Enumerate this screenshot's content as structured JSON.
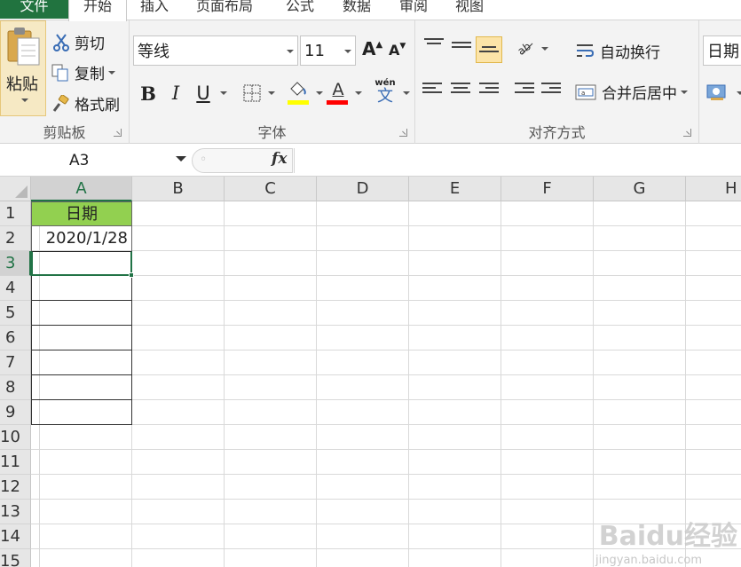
{
  "tabs": {
    "file": "文件",
    "home": "开始",
    "insert": "插入",
    "page_layout": "页面布局",
    "formulas": "公式",
    "data": "数据",
    "review": "审阅",
    "view": "视图"
  },
  "ribbon": {
    "clipboard": {
      "group_label": "剪贴板",
      "paste": "粘贴",
      "cut": "剪切",
      "copy": "复制",
      "format_painter": "格式刷"
    },
    "font": {
      "group_label": "字体",
      "font_name": "等线",
      "font_size": "11",
      "bold": "B",
      "italic": "I",
      "underline": "U",
      "font_color_glyph": "A",
      "grow_glyph": "A",
      "shrink_glyph": "A",
      "phonetic_glyph": "wén",
      "phonetic_char": "文",
      "fill_color": "#ffff00",
      "font_color": "#ff0000"
    },
    "alignment": {
      "group_label": "对齐方式",
      "wrap_text": "自动换行",
      "merge_center": "合并后居中"
    },
    "number": {
      "format": "日期"
    }
  },
  "formula_bar": {
    "name_box": "A3",
    "fx": "fx",
    "formula": ""
  },
  "columns": [
    "A",
    "B",
    "C",
    "D",
    "E",
    "F",
    "G",
    "H"
  ],
  "rows": [
    "1",
    "2",
    "3",
    "4",
    "5",
    "6",
    "7",
    "8",
    "9",
    "10",
    "11",
    "12",
    "13",
    "14",
    "15"
  ],
  "selected": {
    "column": "A",
    "row": "3"
  },
  "cells": {
    "A1": "日期",
    "A2": "2020/1/28"
  },
  "colors": {
    "header_fill": "#92d050",
    "accent": "#217346"
  },
  "watermark": {
    "text": "Baidu经验",
    "sub": "jingyan.baidu.com"
  }
}
